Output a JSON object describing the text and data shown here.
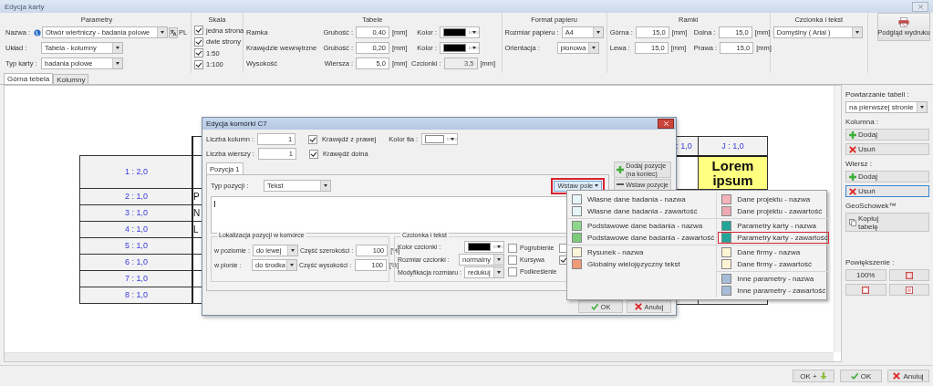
{
  "window": {
    "title": "Edycja karty"
  },
  "toolbar": {
    "parametry": {
      "title": "Parametry",
      "name_label": "Nazwa :",
      "name_value": "Otwór wiertniczy - badania polowe",
      "language": "PL",
      "layout_label": "Układ :",
      "layout_value": "Tabela - kolumny",
      "card_type_label": "Typ karty :",
      "card_type_value": "badania polowe"
    },
    "skala": {
      "title": "Skala",
      "options": [
        {
          "label": "jedna strona",
          "checked": true
        },
        {
          "label": "dwie strony",
          "checked": true
        },
        {
          "label": "1:50",
          "checked": true
        },
        {
          "label": "1:100",
          "checked": true
        }
      ]
    },
    "tabele": {
      "title": "Tabele",
      "rows": [
        {
          "kind": "color",
          "label": "Ramka",
          "field_label": "Grubość :",
          "value": "0,40",
          "unit": "[mm]",
          "extra_label": "Kolor :",
          "color": "#000000"
        },
        {
          "kind": "color",
          "label": "Krawędzie wewnętrzne",
          "field_label": "Grubość :",
          "value": "0,20",
          "unit": "[mm]",
          "extra_label": "Kolor :",
          "color": "#000000"
        },
        {
          "kind": "font",
          "label": "Wysokość",
          "field_label": "Wiersza :",
          "value": "5,0",
          "unit": "[mm]",
          "extra_label": "Czcionki :",
          "extra_value": "3,5",
          "extra_unit": "[mm]"
        }
      ]
    },
    "format_papieru": {
      "title": "Format papieru",
      "fields": [
        {
          "label": "Rozmiar papieru :",
          "value": "A4"
        },
        {
          "label": "Orientacja :",
          "value": "pionowa"
        }
      ]
    },
    "ramki": {
      "title": "Ramki",
      "fields": [
        {
          "label": "Górna :",
          "value": "15,0",
          "unit": "[mm]"
        },
        {
          "label": "Dolna :",
          "value": "15,0",
          "unit": "[mm]"
        },
        {
          "label": "Lewa :",
          "value": "15,0",
          "unit": "[mm]"
        },
        {
          "label": "Prawa :",
          "value": "15,0",
          "unit": "[mm]"
        }
      ]
    },
    "czcionka": {
      "title": "Czcionka i tekst",
      "value": "Domyślny ( Arial )"
    },
    "preview_button": "Podgląd wydruku"
  },
  "tabs": [
    {
      "label": "Górna tebela",
      "selected": true
    },
    {
      "label": "Kolumny",
      "selected": false
    }
  ],
  "preview": {
    "rows": [
      {
        "label": "1 : 2,0"
      },
      {
        "label": "2 : 1,0",
        "fragment": "P"
      },
      {
        "label": "3 : 1,0",
        "fragment": "N"
      },
      {
        "label": "4 : 1,0",
        "fragment": "L"
      },
      {
        "label": "5 : 1,0"
      },
      {
        "label": "6 : 1,0"
      },
      {
        "label": "7 : 1,0"
      },
      {
        "label": "8 : 1,0"
      }
    ],
    "column_headers": [
      ": 1,0",
      "J : 1,0"
    ],
    "highlight_cell": "Lorem ipsum"
  },
  "dialog": {
    "title": "Edycja komórki C7",
    "columns_label": "Liczba kolumn :",
    "columns_value": "1",
    "rows_label": "Liczba wierszy :",
    "rows_value": "1",
    "border_checks": [
      {
        "label": "Krawędź z prawej",
        "checked": true
      },
      {
        "label": "Krawędź dolna",
        "checked": true
      }
    ],
    "bg_color_label": "Kolor tła :",
    "tabs": [
      {
        "label": "Pozycja 1",
        "selected": true
      }
    ],
    "type_label": "Typ pozycji :",
    "type_value": "Tekst",
    "insert_field_button": "Wstaw pole",
    "side_buttons": [
      {
        "label": "Dodaj pozycje (na koniec)",
        "kind": "add"
      },
      {
        "label": "Wstaw pozycje",
        "kind": "insert"
      }
    ],
    "location": {
      "title": "Lokalizacja pozycji w komórce",
      "rows": [
        {
          "label": "w poziomie :",
          "value": "do lewej",
          "share_label": "Część szerokości :",
          "share_value": "100",
          "unit": "[%]"
        },
        {
          "label": "w pionie :",
          "value": "do środka",
          "share_label": "Część wysokości :",
          "share_value": "100",
          "unit": "[%]"
        }
      ]
    },
    "font": {
      "title": "Czcionka i tekst",
      "color_label": "Kolor czcionki :",
      "size_label": "Rozmiar czcionki :",
      "size_value": "normalny",
      "mod_label": "Modyfikacja rozmiaru :",
      "mod_value": "redukuj",
      "styles": [
        {
          "label": "Pogrubienie",
          "checked": false
        },
        {
          "label": "Kursywa",
          "checked": false
        },
        {
          "label": "Podkreślenie",
          "checked": false
        }
      ],
      "extra_checks": [
        {
          "checked": false
        },
        {
          "checked": true
        }
      ]
    },
    "buttons": [
      {
        "label": "OK",
        "kind": "ok"
      },
      {
        "label": "Anuluj",
        "kind": "cancel"
      }
    ]
  },
  "insert_menu": {
    "columns": [
      {
        "groups": [
          {
            "items": [
              {
                "label": "Własne dane badania - nazwa",
                "color": "#e6f5f7",
                "selected": false
              },
              {
                "label": "Własne dane badania - zawartość",
                "color": "#e6f5f7",
                "selected": false
              }
            ]
          },
          {
            "items": [
              {
                "label": "Podstawowe dane badania - nazwa",
                "color": "#8ed88e",
                "selected": false
              },
              {
                "label": "Podstawowe dane badania - zawartość",
                "color": "#7ccc7c",
                "selected": false
              }
            ]
          },
          {
            "items": [
              {
                "label": "Rysunek - nazwa",
                "color": "#fdf5d8",
                "selected": false
              },
              {
                "label": "Globalny wielojęzyczny tekst",
                "color": "#f09a76",
                "selected": false
              }
            ]
          }
        ]
      },
      {
        "groups": [
          {
            "items": [
              {
                "label": "Dane projektu - nazwa",
                "color": "#f4b2bb",
                "selected": false
              },
              {
                "label": "Dane projektu - zawartość",
                "color": "#eeaab4",
                "selected": false
              }
            ]
          },
          {
            "items": [
              {
                "label": "Parametry karty - nazwa",
                "color": "#22a597",
                "selected": false
              },
              {
                "label": "Parametry karty - zawartość",
                "color": "#22a597",
                "selected": true
              }
            ]
          },
          {
            "items": [
              {
                "label": "Dane firmy - nazwa",
                "color": "#fcf4d2",
                "selected": false
              },
              {
                "label": "Dane firmy - zawartość",
                "color": "#fcf4d2",
                "selected": false
              }
            ]
          },
          {
            "items": [
              {
                "label": "Inne parametry - nazwa",
                "color": "#a7bcd8",
                "selected": false
              },
              {
                "label": "Inne parametry - zawartość",
                "color": "#a7bcd8",
                "selected": false
              }
            ]
          }
        ]
      }
    ]
  },
  "sidebar": {
    "repeat_label": "Powtarzanie tabeli :",
    "repeat_value": "na pierwszej stronie",
    "sections": [
      {
        "label": "Kolumna :",
        "buttons": [
          {
            "label": "Dodaj",
            "kind": "add",
            "focused": false
          },
          {
            "label": "Usuń",
            "kind": "remove",
            "focused": false
          }
        ]
      },
      {
        "label": "Wiersz :",
        "buttons": [
          {
            "label": "Dodaj",
            "kind": "add",
            "focused": false
          },
          {
            "label": "Usuń",
            "kind": "remove",
            "focused": true
          }
        ]
      }
    ],
    "clipboard_label": "GeoSchowek™",
    "copy_button": "Kopiuj tabelę",
    "zoom_label": "Powiększenie :",
    "zoom_buttons": [
      {
        "kind": "text",
        "label": "100%"
      },
      {
        "kind": "fit"
      },
      {
        "kind": "page"
      },
      {
        "kind": "width"
      }
    ]
  },
  "footer_buttons": [
    {
      "label": "OK +",
      "kind": "ok_plus"
    },
    {
      "label": "OK",
      "kind": "ok"
    },
    {
      "label": "Anuluj",
      "kind": "cancel"
    }
  ]
}
